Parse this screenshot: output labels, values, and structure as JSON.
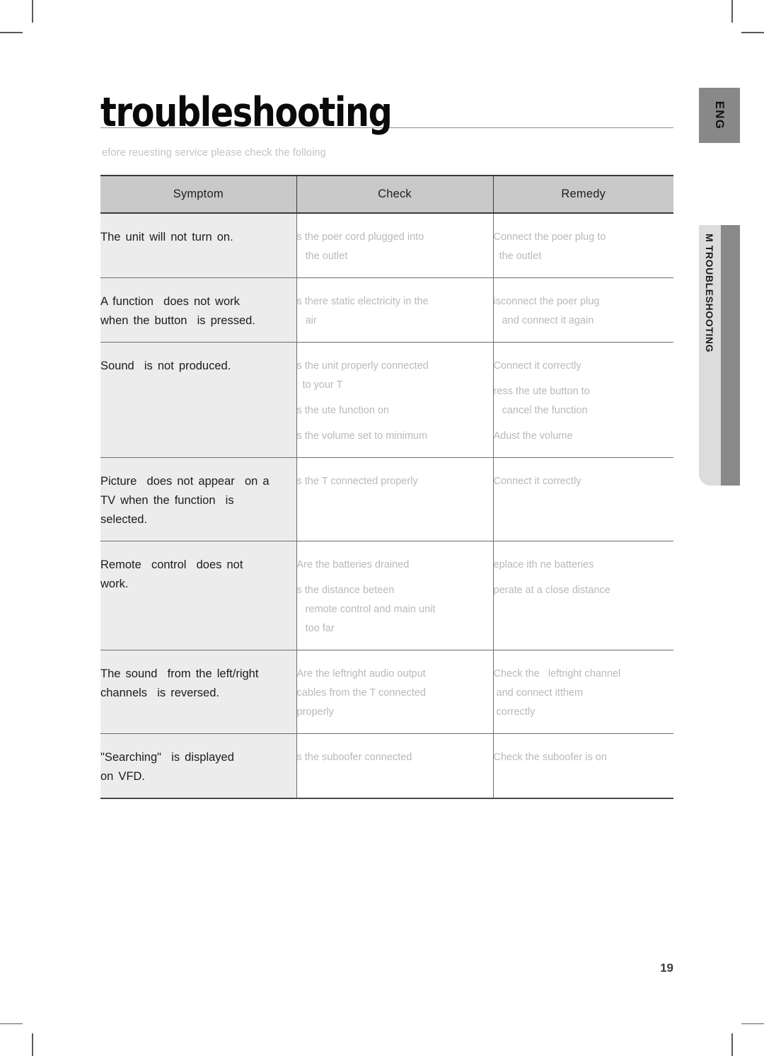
{
  "document": {
    "title": "troubleshooting",
    "subtitle": "efore reuesting service please check the folloing",
    "page_number": "19"
  },
  "side_tabs": {
    "language": "ENG",
    "section": "M TROUBLESHOOTING"
  },
  "table": {
    "headers": {
      "symptom": "Symptom",
      "check": "Check",
      "remedy": "Remedy"
    },
    "rows": [
      {
        "symptom": "The unit will not turn on.",
        "check": [
          "s the poer cord plugged into\n   the outlet"
        ],
        "remedy": [
          "Connect the poer plug to\n  the outlet"
        ]
      },
      {
        "symptom": "A function  does not work\nwhen the button  is pressed.",
        "check": [
          "s there static electricity in the\n   air"
        ],
        "remedy": [
          "isconnect the poer plug\n   and connect it again"
        ]
      },
      {
        "symptom": "Sound  is not produced.",
        "check": [
          "s the unit properly connected\n  to your T",
          "s the ute function on",
          "s the volume set to minimum"
        ],
        "remedy": [
          "Connect it correctly",
          "ress the ute button to\n   cancel the function",
          "Adust the volume"
        ]
      },
      {
        "symptom": "Picture  does not appear  on a\nTV when the function  is\nselected.",
        "check": [
          "s the T connected properly"
        ],
        "remedy": [
          "Connect it correctly"
        ]
      },
      {
        "symptom": "Remote  control  does not\nwork.",
        "check": [
          "Are the batteries drained",
          "s the distance beteen\n   remote control and main unit\n   too far"
        ],
        "remedy": [
          "eplace ith ne batteries",
          "perate at a close distance"
        ]
      },
      {
        "symptom": "The sound  from the left/right\nchannels  is reversed.",
        "check": [
          "Are the leftright audio output\ncables from the T connected\nproperly"
        ],
        "remedy": [
          "Check the   leftright channel\n and connect itthem\n correctly"
        ]
      },
      {
        "symptom": "\"Searching\"  is displayed\non VFD.",
        "check": [
          "s the suboofer connected"
        ],
        "remedy": [
          "Check the suboofer is on"
        ]
      }
    ]
  }
}
